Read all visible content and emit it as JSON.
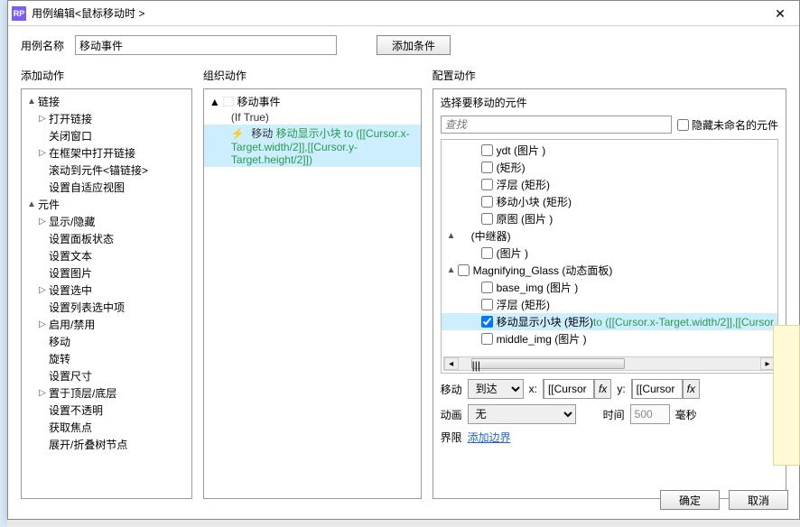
{
  "titlebar": {
    "icon_text": "RP",
    "title": "用例编辑<鼠标移动时 >",
    "close": "✕"
  },
  "toprow": {
    "name_label": "用例名称",
    "name_value": "移动事件",
    "add_condition": "添加条件"
  },
  "col1": {
    "title": "添加动作",
    "tree": [
      {
        "indent": 0,
        "tw": "▲",
        "label": "链接"
      },
      {
        "indent": 1,
        "tw": "▷",
        "label": "打开链接"
      },
      {
        "indent": 1,
        "tw": "",
        "label": "关闭窗口"
      },
      {
        "indent": 1,
        "tw": "▷",
        "label": "在框架中打开链接"
      },
      {
        "indent": 1,
        "tw": "",
        "label": "滚动到元件<锚链接>"
      },
      {
        "indent": 1,
        "tw": "",
        "label": "设置自适应视图"
      },
      {
        "indent": 0,
        "tw": "▲",
        "label": "元件"
      },
      {
        "indent": 1,
        "tw": "▷",
        "label": "显示/隐藏"
      },
      {
        "indent": 1,
        "tw": "",
        "label": "设置面板状态"
      },
      {
        "indent": 1,
        "tw": "",
        "label": "设置文本"
      },
      {
        "indent": 1,
        "tw": "",
        "label": "设置图片"
      },
      {
        "indent": 1,
        "tw": "▷",
        "label": "设置选中"
      },
      {
        "indent": 1,
        "tw": "",
        "label": "设置列表选中项"
      },
      {
        "indent": 1,
        "tw": "▷",
        "label": "启用/禁用"
      },
      {
        "indent": 1,
        "tw": "",
        "label": "移动"
      },
      {
        "indent": 1,
        "tw": "",
        "label": "旋转"
      },
      {
        "indent": 1,
        "tw": "",
        "label": "设置尺寸"
      },
      {
        "indent": 1,
        "tw": "▷",
        "label": "置于顶层/底层"
      },
      {
        "indent": 1,
        "tw": "",
        "label": "设置不透明"
      },
      {
        "indent": 1,
        "tw": "",
        "label": "获取焦点"
      },
      {
        "indent": 1,
        "tw": "",
        "label": "展开/折叠树节点"
      }
    ]
  },
  "col2": {
    "title": "组织动作",
    "case_icon": "⬛",
    "case_label": "移动事件",
    "case_cond": "(If True)",
    "action_prefix": "移动",
    "action_green": "移动显示小块 to ([[Cursor.x-Target.width/2]],[[Cursor.y-Target.height/2]])"
  },
  "col3": {
    "title": "配置动作",
    "select_label": "选择要移动的元件",
    "search_placeholder": "查找",
    "hide_unnamed": "隐藏未命名的元件",
    "tree": [
      {
        "indent": 1,
        "tw": "",
        "checked": false,
        "label": "ydt (图片 )"
      },
      {
        "indent": 1,
        "tw": "",
        "checked": false,
        "label": "(矩形)"
      },
      {
        "indent": 1,
        "tw": "",
        "checked": false,
        "label": "浮层 (矩形)"
      },
      {
        "indent": 1,
        "tw": "",
        "checked": false,
        "label": "移动小块 (矩形)"
      },
      {
        "indent": 1,
        "tw": "",
        "checked": false,
        "label": "原图 (图片 )"
      },
      {
        "indent": 0,
        "tw": "▲",
        "checked": null,
        "label": "(中继器)"
      },
      {
        "indent": 1,
        "tw": "",
        "checked": false,
        "label": "(图片 )"
      },
      {
        "indent": 0,
        "tw": "▲",
        "checked": false,
        "label": "Magnifying_Glass (动态面板)"
      },
      {
        "indent": 1,
        "tw": "",
        "checked": false,
        "label": "base_img (图片 )"
      },
      {
        "indent": 1,
        "tw": "",
        "checked": false,
        "label": "浮层 (矩形)"
      },
      {
        "indent": 1,
        "tw": "",
        "checked": true,
        "label": "移动显示小块 (矩形)",
        "selected": true,
        "greentail": " to ([[Cursor.x-Target.width/2]],[[Cursor"
      },
      {
        "indent": 1,
        "tw": "",
        "checked": false,
        "label": "middle_img (图片 )"
      }
    ],
    "move_label": "移动",
    "move_type": "到达",
    "x_label": "x:",
    "x_value": "[[Cursor",
    "y_label": "y:",
    "y_value": "[[Cursor",
    "fx": "fx",
    "anim_label": "动画",
    "anim_value": "无",
    "time_label": "时间",
    "time_value": "500",
    "ms": "毫秒",
    "bounds_label": "界限",
    "bounds_link": "添加边界"
  },
  "footer": {
    "ok": "确定",
    "cancel": "取消"
  }
}
